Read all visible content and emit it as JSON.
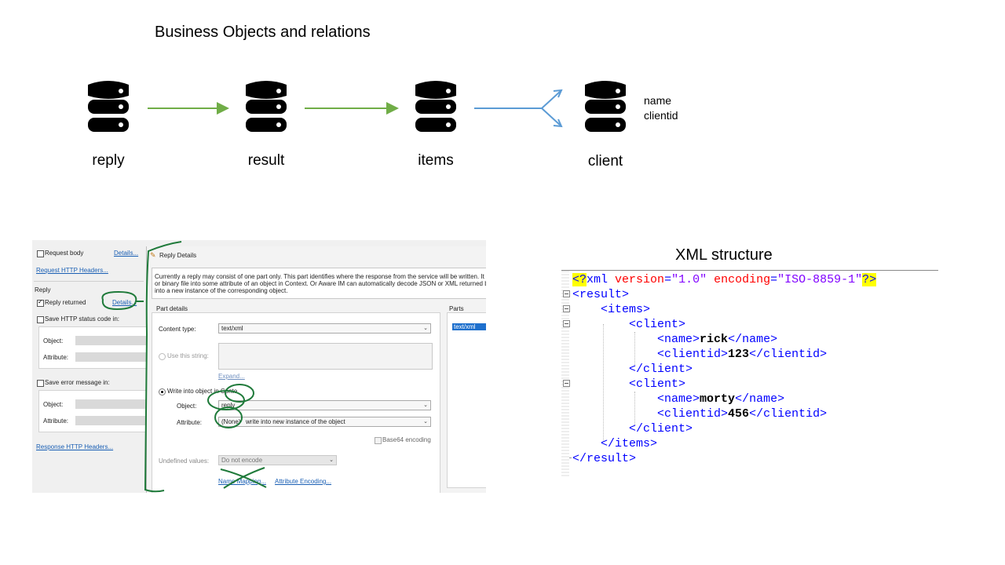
{
  "diagram": {
    "title": "Business Objects and relations",
    "nodes": [
      {
        "label": "reply"
      },
      {
        "label": "result"
      },
      {
        "label": "items"
      },
      {
        "label": "client"
      }
    ],
    "client_attributes": [
      "name",
      "clientid"
    ],
    "colors": {
      "icon": "#000000",
      "arrow_one": "#70ad47",
      "arrow_many": "#5b9bd5",
      "annotation": "#1f7a3a"
    }
  },
  "screenshot": {
    "left": {
      "request_body": "Request body",
      "details_top": "Details...",
      "request_headers": "Request HTTP Headers...",
      "reply_section": "Reply",
      "reply_returned": "Reply returned",
      "details_reply": "Details...",
      "save_status": "Save HTTP status code in:",
      "object_label": "Object:",
      "attribute_label": "Attribute:",
      "save_error": "Save error message in:",
      "object_label2": "Object:",
      "attribute_label2": "Attribute:",
      "response_headers": "Response HTTP Headers..."
    },
    "dialog": {
      "title": "Reply Details",
      "description_1": "Currently a reply may consist of one part only. This part identifies where the response from the service will be written. It ca",
      "description_2": "or binary file into some attribute of an object in Context. Or Aware IM can automatically decode JSON or XML returned by",
      "description_3": "into a new instance of the corresponding object.",
      "part_details": "Part details",
      "parts": "Parts",
      "parts_item": "text/xml",
      "content_type_label": "Content type:",
      "content_type_value": "text/xml",
      "use_string": "Use this string:",
      "expand": "Expand...",
      "write_into": "Write into object in Conte",
      "object_label": "Object:",
      "object_value": "reply",
      "attribute_label": "Attribute:",
      "attribute_value": "(None)",
      "attribute_rest": "write into new instance of the object",
      "base64": "Base64 encoding",
      "undefined_label": "Undefined values:",
      "undefined_value": "Do not encode",
      "name_mapping": "Name Mapping...",
      "attribute_encoding": "Attribute Encoding..."
    }
  },
  "xml": {
    "title": "XML structure",
    "declaration": {
      "open": "<?",
      "name": "xml",
      "attr1": "version",
      "val1": "\"1.0\"",
      "attr2": "encoding",
      "val2": "\"ISO-8859-1\"",
      "close": "?>"
    },
    "result_open": "<result>",
    "items_open": "<items>",
    "client_open": "<client>",
    "client_open_2": "<client>",
    "name_open": "<name>",
    "name_close": "</name>",
    "name_open_2": "<name>",
    "name_close_2": "</name>",
    "clientid_open": "<clientid>",
    "clientid_close": "</clientid>",
    "clientid_open_2": "<clientid>",
    "clientid_close_2": "</clientid>",
    "client_close": "</client>",
    "client_close_2": "</client>",
    "items_close": "</items>",
    "result_close": "</result>",
    "name1": "rick",
    "id1": "123",
    "name2": "morty",
    "id2": "456"
  }
}
